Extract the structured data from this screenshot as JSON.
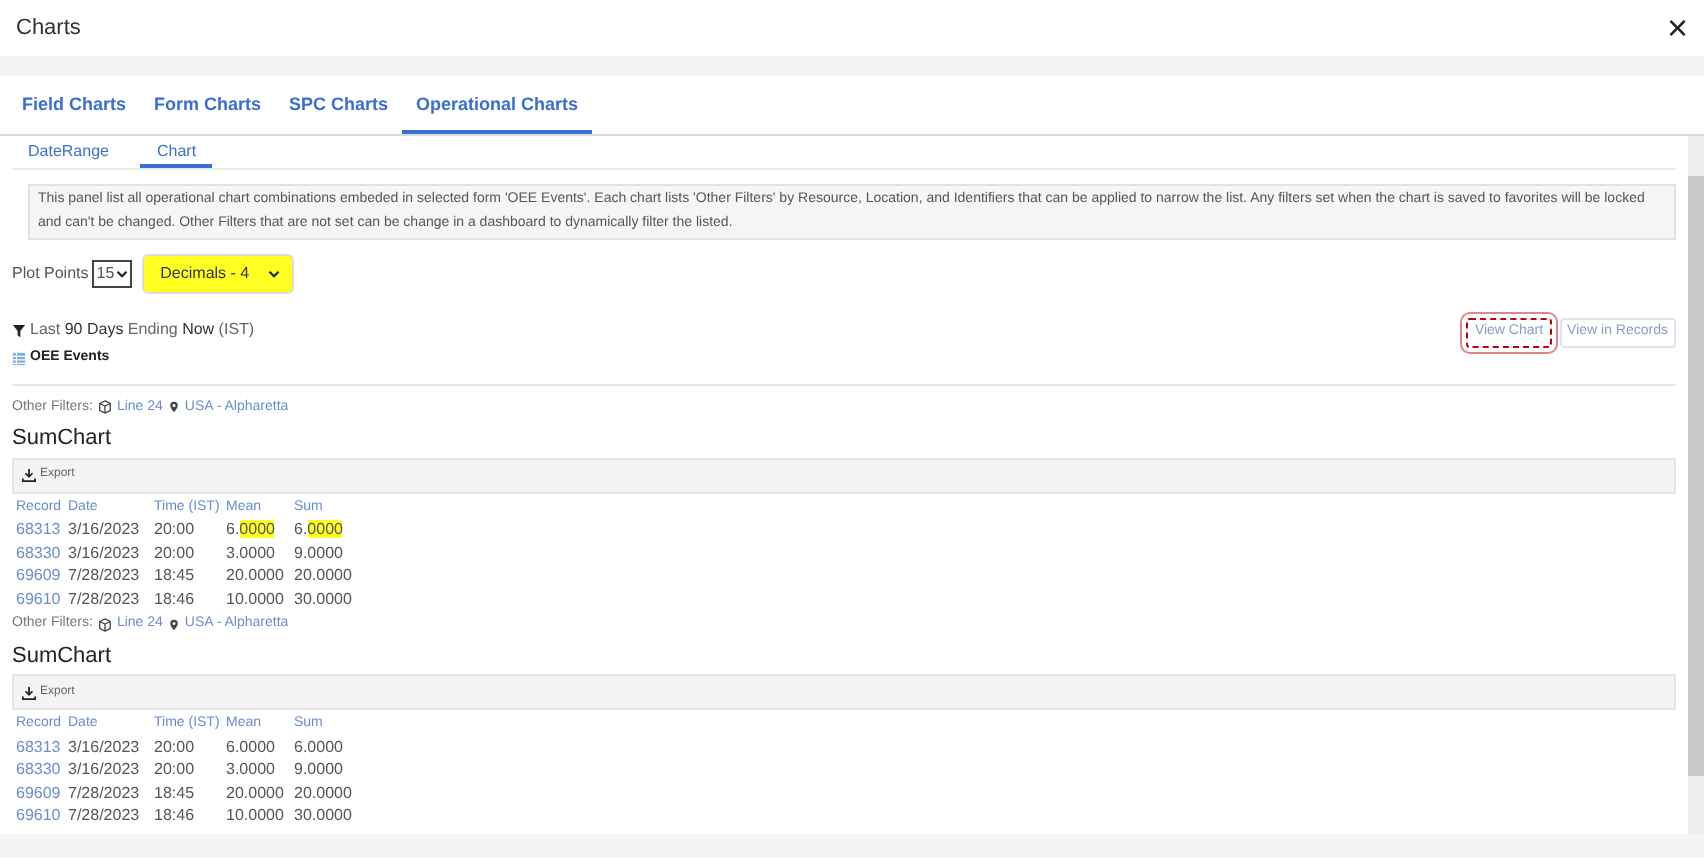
{
  "dialog": {
    "title": "Charts",
    "close": "×"
  },
  "tabs": [
    {
      "label": "Field Charts",
      "selected": false
    },
    {
      "label": "Form Charts",
      "selected": false
    },
    {
      "label": "SPC Charts",
      "selected": false
    },
    {
      "label": "Operational Charts",
      "selected": true
    }
  ],
  "subtabs": [
    {
      "label": "DateRange",
      "selected": false
    },
    {
      "label": "Chart",
      "selected": true
    }
  ],
  "info": "This panel list all operational chart combinations embeded in selected form 'OEE Events'. Each chart lists 'Other Filters' by Resource, Location, and Identifiers that can be applied to narrow the list. Any filters set when the chart is saved to favorites will be locked and can't be changed. Other Filters that are not set can be change in a dashboard to dynamically filter the listed.",
  "plot_points": {
    "label": "Plot Points",
    "value": "15"
  },
  "decimals": {
    "value": "Decimals - 4",
    "highlighted": true
  },
  "date_filter": "Last **90 Days** Ending **Now** (IST)",
  "form": "OEE Events",
  "actions": [
    {
      "label": "View Chart",
      "selected": true
    },
    {
      "label": "View in Records",
      "selected": false
    }
  ],
  "charts": [
    {
      "other_filters_label": "Other Filters:",
      "filters": [
        {
          "kind": "resource",
          "label": "Line 24"
        },
        {
          "kind": "location",
          "label": "USA - Alpharetta"
        }
      ],
      "title": "SumChart",
      "export": "Export",
      "columns": [
        "Record",
        "Date",
        "Time (IST)",
        "Mean",
        "Sum"
      ],
      "rows": [
        {
          "record": "68313",
          "date": "3/16/2023",
          "time": "20:00",
          "mean": "6.0000",
          "sum": "6.0000",
          "highlighted": true
        },
        {
          "record": "68330",
          "date": "3/16/2023",
          "time": "20:00",
          "mean": "3.0000",
          "sum": "9.0000",
          "highlighted": false
        },
        {
          "record": "69609",
          "date": "7/28/2023",
          "time": "18:45",
          "mean": "20.0000",
          "sum": "20.0000",
          "highlighted": false
        },
        {
          "record": "69610",
          "date": "7/28/2023",
          "time": "18:46",
          "mean": "10.0000",
          "sum": "30.0000",
          "highlighted": false
        }
      ]
    },
    {
      "other_filters_label": "Other Filters:",
      "filters": [
        {
          "kind": "resource",
          "label": "Line 24"
        },
        {
          "kind": "location",
          "label": "USA - Alpharetta"
        }
      ],
      "title": "SumChart",
      "export": "Export",
      "columns": [
        "Record",
        "Date",
        "Time (IST)",
        "Mean",
        "Sum"
      ],
      "rows": [
        {
          "record": "68313",
          "date": "3/16/2023",
          "time": "20:00",
          "mean": "6.0000",
          "sum": "6.0000",
          "highlighted": false
        },
        {
          "record": "68330",
          "date": "3/16/2023",
          "time": "20:00",
          "mean": "3.0000",
          "sum": "9.0000",
          "highlighted": false
        },
        {
          "record": "69609",
          "date": "7/28/2023",
          "time": "18:45",
          "mean": "20.0000",
          "sum": "20.0000",
          "highlighted": false
        },
        {
          "record": "69610",
          "date": "7/28/2023",
          "time": "18:46",
          "mean": "10.0000",
          "sum": "30.0000",
          "highlighted": false
        }
      ]
    }
  ]
}
